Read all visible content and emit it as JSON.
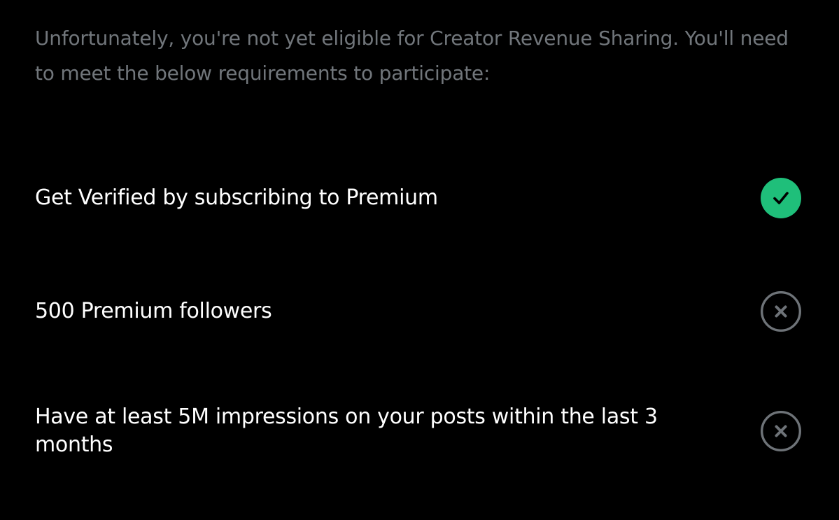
{
  "intro": {
    "text": "Unfortunately, you're not yet eligible for Creator Revenue Sharing. You'll need to meet the below requirements to participate:"
  },
  "requirements": [
    {
      "label": "Get Verified by subscribing to Premium",
      "met": true,
      "icon": "check-circle-icon"
    },
    {
      "label": "500 Premium followers",
      "met": false,
      "icon": "x-circle-icon"
    },
    {
      "label": "Have at least 5M impressions on your posts within the last 3 months",
      "met": false,
      "icon": "x-circle-icon"
    }
  ],
  "colors": {
    "background": "#000000",
    "intro_text": "#71767b",
    "label_text": "#ffffff",
    "met": "#1fbf7a",
    "unmet": "#6e7378"
  }
}
